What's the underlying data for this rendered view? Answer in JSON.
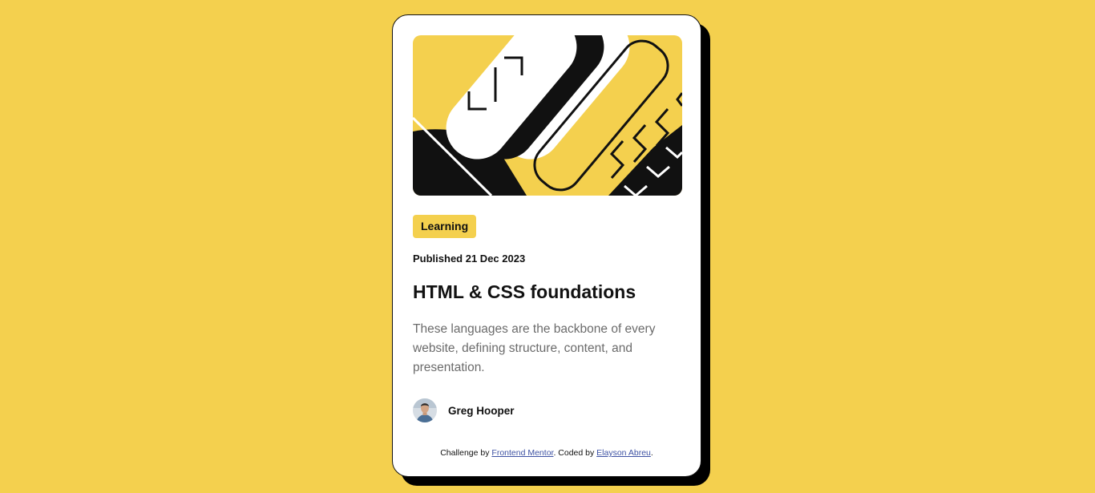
{
  "page": {
    "background_color": "#F4D04E"
  },
  "card": {
    "hero_icon": "abstract-illustration",
    "tag": "Learning",
    "published": "Published 21 Dec 2023",
    "title": "HTML & CSS foundations",
    "description": "These languages are the backbone of every website, defining structure, content, and presentation.",
    "author": {
      "avatar_icon": "avatar-photo",
      "name": "Greg Hooper"
    }
  },
  "attribution": {
    "prefix": "Challenge by ",
    "link1": "Frontend Mentor",
    "middle": ". Coded by ",
    "link2": "Elayson Abreu",
    "suffix": "."
  },
  "colors": {
    "accent_yellow": "#F4D04E",
    "text_dark": "#111111",
    "text_muted": "#6B6B6B",
    "link": "#3E52A3"
  }
}
